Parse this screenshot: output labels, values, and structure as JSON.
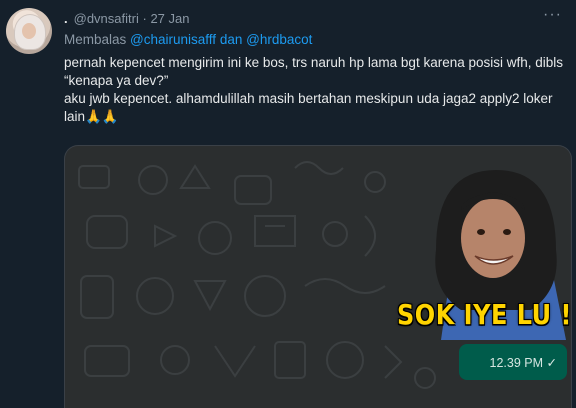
{
  "tweet": {
    "avatar_alt": "profile photo",
    "display_dot": ".",
    "handle": "@dvnsafitri",
    "separator": "·",
    "date": "27 Jan",
    "more_label": "···",
    "reply_prefix": "Membalas",
    "reply_mention_1": "@chairunisafff",
    "reply_joiner": "dan",
    "reply_mention_2": "@hrdbacot",
    "text_line_1": "pernah kepencet mengirim ini ke bos, trs naruh hp lama bgt karena posisi wfh, dibls “kenapa ya dev?”",
    "text_line_2": "aku jwb kepencet. alhamdulillah masih bertahan meskipun uda jaga2 apply2 loker lain",
    "text_emoji": "🙏🙏"
  },
  "media": {
    "sticker_caption": "SOK IYE LU !!!",
    "message_time": "12.39 PM",
    "check_icon": "✓"
  },
  "colors": {
    "background": "#15202b",
    "link": "#1d9bf0",
    "chat_bubble": "#005c4b",
    "sticker_text": "#ffd400"
  }
}
